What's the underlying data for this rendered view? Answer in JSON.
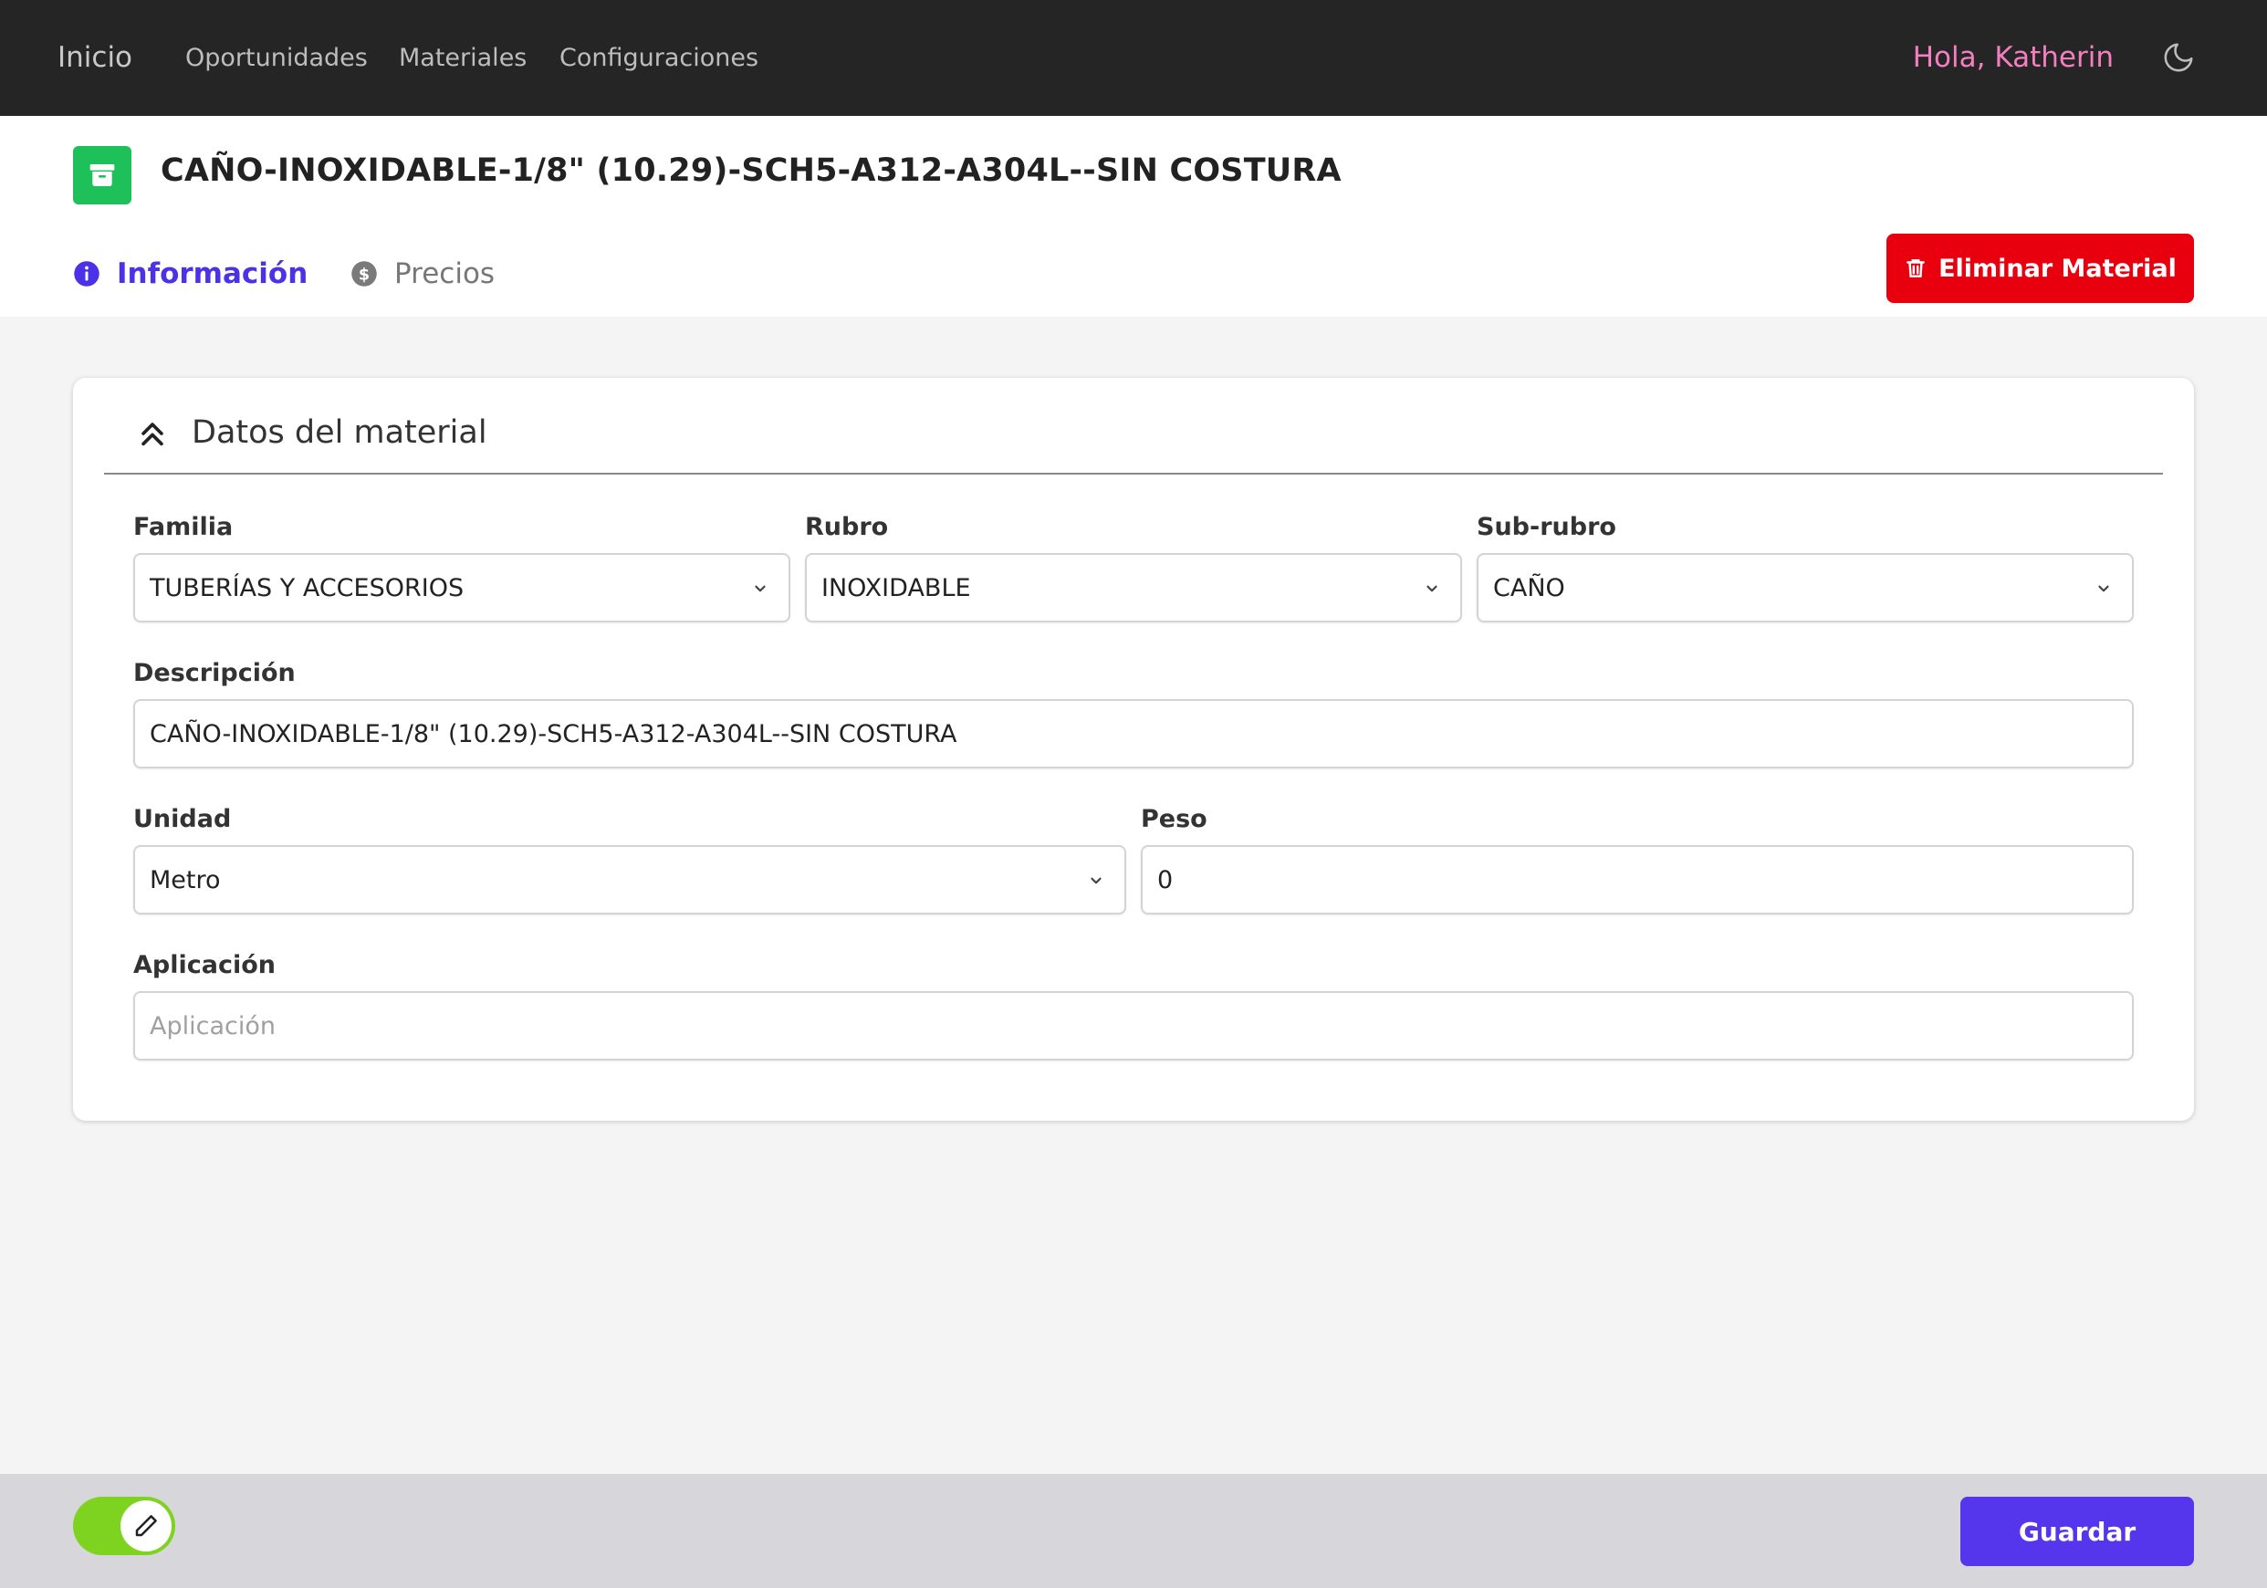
{
  "nav": {
    "home": "Inicio",
    "links": [
      "Oportunidades",
      "Materiales",
      "Configuraciones"
    ],
    "greeting": "Hola, Katherin",
    "theme_icon": "moon-icon"
  },
  "header": {
    "icon": "archive-box-icon",
    "icon_color": "#1ec05a",
    "title": "CAÑO-INOXIDABLE-1/8\" (10.29)-SCH5-A312-A304L--SIN COSTURA",
    "tabs": [
      {
        "label": "Información",
        "icon": "info-circle-icon",
        "active": true
      },
      {
        "label": "Precios",
        "icon": "dollar-circle-icon",
        "active": false
      }
    ],
    "delete_button": "Eliminar Material",
    "delete_color": "#e8000f"
  },
  "card": {
    "title": "Datos del material",
    "collapse_icon": "chevron-double-up-icon",
    "fields": {
      "familia": {
        "label": "Familia",
        "value": "TUBERÍAS Y ACCESORIOS"
      },
      "rubro": {
        "label": "Rubro",
        "value": "INOXIDABLE"
      },
      "subrubro": {
        "label": "Sub-rubro",
        "value": "CAÑO"
      },
      "descripcion": {
        "label": "Descripción",
        "value": "CAÑO-INOXIDABLE-1/8\" (10.29)-SCH5-A312-A304L--SIN COSTURA"
      },
      "unidad": {
        "label": "Unidad",
        "value": "Metro"
      },
      "peso": {
        "label": "Peso",
        "value": "0"
      },
      "aplicacion": {
        "label": "Aplicación",
        "placeholder": "Aplicación"
      }
    }
  },
  "footer": {
    "edit_toggle": {
      "on": true,
      "icon": "pencil-icon",
      "color": "#7ed321"
    },
    "save_button": "Guardar",
    "save_color": "#5536ec"
  }
}
